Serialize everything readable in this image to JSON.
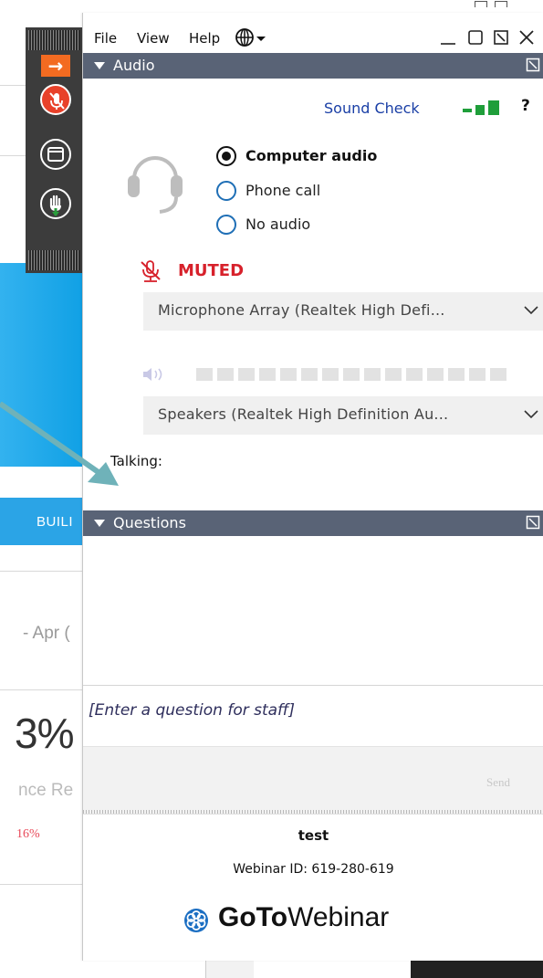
{
  "background_page": {
    "tab_label": "BUILI",
    "date_fragment": "- Apr (",
    "percent_fragment": "3%",
    "rate_fragment": "nce Re",
    "change_fragment": "16%"
  },
  "toolbar": {
    "icons": [
      "arrow-right-icon",
      "microphone-muted-icon",
      "screen-icon",
      "raise-hand-icon"
    ],
    "accent_color": "#f36b21",
    "mic_color": "#e8412a"
  },
  "menubar": {
    "file": "File",
    "view": "View",
    "help": "Help"
  },
  "audio": {
    "title": "Audio",
    "sound_check": "Sound Check",
    "help": "?",
    "options": [
      {
        "label": "Computer audio",
        "selected": true
      },
      {
        "label": "Phone call",
        "selected": false
      },
      {
        "label": "No audio",
        "selected": false
      }
    ],
    "muted_label": "MUTED",
    "microphone": "Microphone Array (Realtek High Defi...",
    "speakers": "Speakers (Realtek High Definition Au...",
    "talking_label": "Talking:"
  },
  "questions": {
    "title": "Questions",
    "placeholder": "[Enter a question for staff]",
    "send_label": "Send"
  },
  "footer": {
    "webinar_name": "test",
    "webinar_id": "Webinar ID: 619-280-619",
    "logo_bold": "GoTo",
    "logo_light": "Webinar"
  },
  "colors": {
    "section_header": "#596376",
    "link": "#1a3fa6",
    "muted": "#d7212b",
    "signal": "#1f9e3a"
  }
}
